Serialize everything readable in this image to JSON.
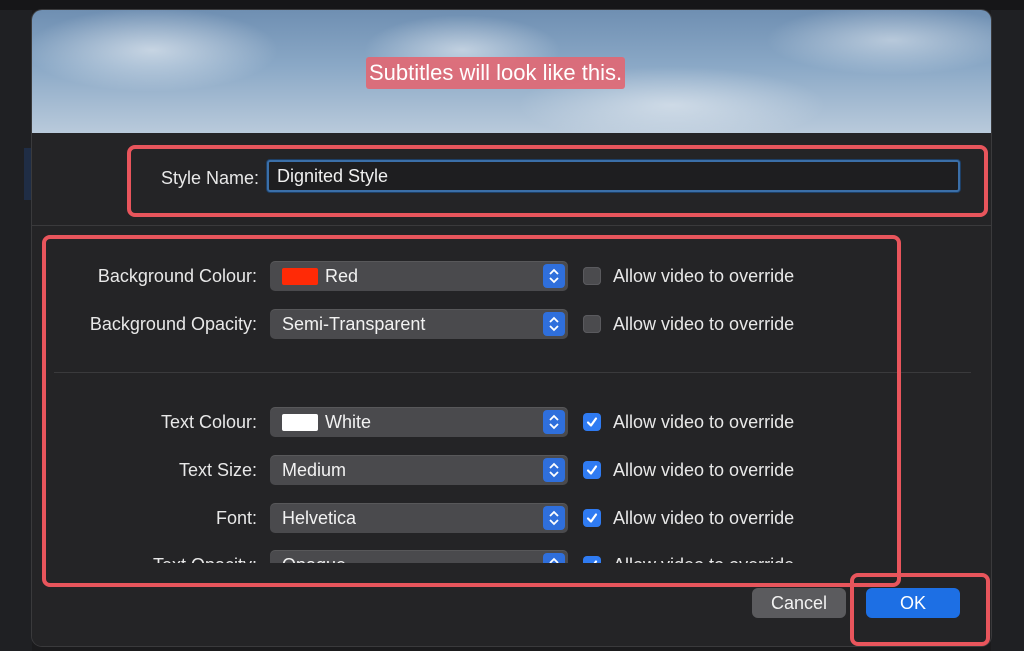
{
  "preview": {
    "caption": "Subtitles will look like this."
  },
  "style_name": {
    "label": "Style Name:",
    "value": "Dignited Style"
  },
  "rows": [
    {
      "label": "Background Colour:",
      "value": "Red",
      "swatch": "#ff2a06",
      "override_label": "Allow video to override",
      "override_checked": false
    },
    {
      "label": "Background Opacity:",
      "value": "Semi-Transparent",
      "override_label": "Allow video to override",
      "override_checked": false
    },
    {
      "label": "Text Colour:",
      "value": "White",
      "swatch": "#ffffff",
      "override_label": "Allow video to override",
      "override_checked": true
    },
    {
      "label": "Text Size:",
      "value": "Medium",
      "override_label": "Allow video to override",
      "override_checked": true
    },
    {
      "label": "Font:",
      "value": "Helvetica",
      "override_label": "Allow video to override",
      "override_checked": true
    },
    {
      "label": "Text Opacity:",
      "value": "Opaque",
      "override_label": "Allow video to override",
      "override_checked": true
    }
  ],
  "buttons": {
    "cancel": "Cancel",
    "ok": "OK"
  },
  "colors": {
    "highlight": "#e8555c",
    "accent": "#2f7bf2"
  }
}
